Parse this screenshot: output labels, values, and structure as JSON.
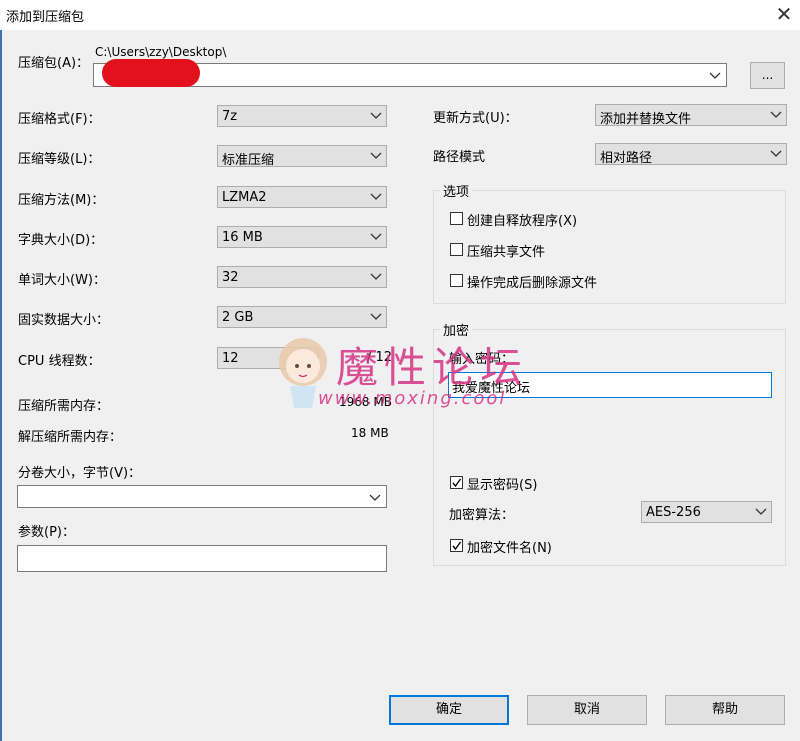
{
  "window": {
    "title": "添加到压缩包",
    "close_glyph": "✕"
  },
  "archive": {
    "label": "压缩包(A)：",
    "path": "C:\\Users\\zzy\\Desktop\\",
    "browse_label": "..."
  },
  "left_fields": [
    {
      "label": "压缩格式(F)：",
      "value": "7z"
    },
    {
      "label": "压缩等级(L)：",
      "value": "标准压缩"
    },
    {
      "label": "压缩方法(M)：",
      "value": "LZMA2"
    },
    {
      "label": "字典大小(D)：",
      "value": "16 MB"
    },
    {
      "label": "单词大小(W)：",
      "value": "32"
    },
    {
      "label": "固实数据大小：",
      "value": "2 GB"
    },
    {
      "label": "CPU 线程数：",
      "value": "12",
      "suffix": "/ 12"
    }
  ],
  "memory": {
    "compress_label": "压缩所需内存：",
    "compress_value": "1968 MB",
    "decompress_label": "解压缩所需内存：",
    "decompress_value": "18 MB"
  },
  "volume": {
    "label": "分卷大小，字节(V)：",
    "value": ""
  },
  "params": {
    "label": "参数(P)：",
    "value": ""
  },
  "update_mode": {
    "label": "更新方式(U)：",
    "value": "添加并替换文件"
  },
  "path_mode": {
    "label": "路径模式",
    "value": "相对路径"
  },
  "options": {
    "title": "选项",
    "items": [
      {
        "label": "创建自释放程序(X)",
        "checked": false
      },
      {
        "label": "压缩共享文件",
        "checked": false
      },
      {
        "label": "操作完成后删除源文件",
        "checked": false
      }
    ]
  },
  "encryption": {
    "title": "加密",
    "password_label": "输入密码：",
    "password_value": "我爱魔性论坛",
    "show_password_label": "显示密码(S)",
    "show_password_checked": true,
    "method_label": "加密算法：",
    "method_value": "AES-256",
    "encrypt_names_label": "加密文件名(N)",
    "encrypt_names_checked": true
  },
  "watermark": {
    "text": "魔性论坛",
    "url": "www.moxing.cool"
  },
  "buttons": {
    "ok": "确定",
    "cancel": "取消",
    "help": "帮助"
  },
  "colors": {
    "accent": "#0078d7",
    "redact": "#e3111b",
    "watermark": "#d63384"
  }
}
